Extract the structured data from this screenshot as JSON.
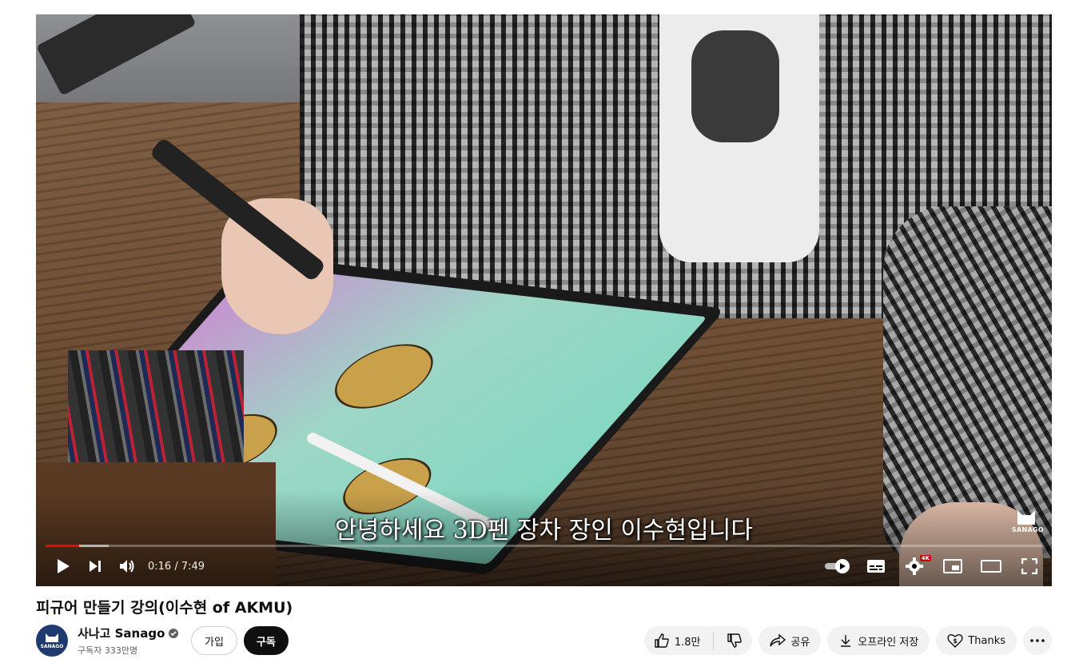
{
  "video": {
    "subtitle": "안녕하세요 3D펜 장차 장인 이수현입니다",
    "watermark": "SANAGO",
    "time_display": "0:16 / 7:49",
    "progress_played": 0.034,
    "progress_loaded": 0.063,
    "quality_badge": "4K"
  },
  "meta": {
    "title": "피규어 만들기 강의(이수현 of AKMU)",
    "channel_name": "사나고 Sanago",
    "subscribers": "구독자 333만명",
    "avatar_text": "SANAGO",
    "join_label": "가입",
    "subscribe_label": "구독"
  },
  "actions": {
    "like_count": "1.8만",
    "share_label": "공유",
    "download_label": "오프라인 저장",
    "thanks_label": "Thanks"
  },
  "colors": {
    "progress": "#ff0000",
    "subscribe_bg": "#0f0f0f",
    "pill_bg": "#f2f2f2"
  }
}
